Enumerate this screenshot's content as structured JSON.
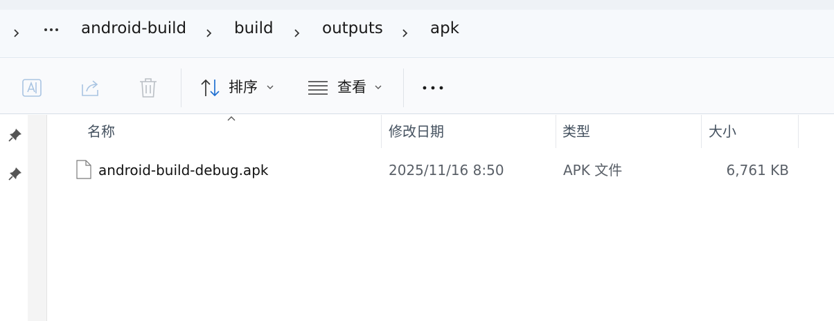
{
  "breadcrumb": {
    "items": [
      "android-build",
      "build",
      "outputs",
      "apk"
    ]
  },
  "toolbar": {
    "sort_label": "排序",
    "view_label": "查看"
  },
  "columns": {
    "name": "名称",
    "modified": "修改日期",
    "type": "类型",
    "size": "大小"
  },
  "files": [
    {
      "name": "android-build-debug.apk",
      "modified": "2025/11/16 8:50",
      "type": "APK 文件",
      "size": "6,761 KB"
    }
  ],
  "colors": {
    "accent": "#1f6fd1",
    "disabled_icon": "#a9c4e2",
    "header_text": "#44515f"
  }
}
